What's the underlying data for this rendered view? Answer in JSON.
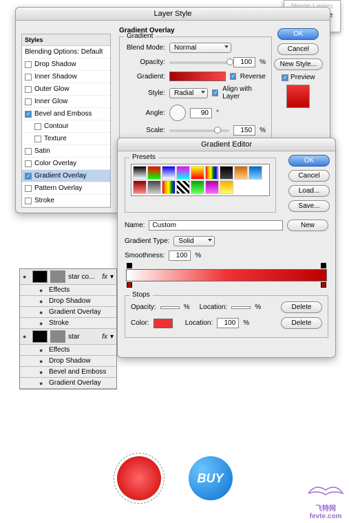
{
  "menu": {
    "merge_layers": "Merge Layers",
    "merge_visible": "Merge Visible"
  },
  "layer_style": {
    "title": "Layer Style",
    "styles_header": "Styles",
    "blending_default": "Blending Options: Default",
    "items": {
      "drop_shadow": "Drop Shadow",
      "inner_shadow": "Inner Shadow",
      "outer_glow": "Outer Glow",
      "inner_glow": "Inner Glow",
      "bevel_emboss": "Bevel and Emboss",
      "contour": "Contour",
      "texture": "Texture",
      "satin": "Satin",
      "color_overlay": "Color Overlay",
      "gradient_overlay": "Gradient Overlay",
      "pattern_overlay": "Pattern Overlay",
      "stroke": "Stroke"
    },
    "panel_title": "Gradient Overlay",
    "group_title": "Gradient",
    "blend_mode_label": "Blend Mode:",
    "blend_mode_value": "Normal",
    "opacity_label": "Opacity:",
    "opacity_value": "100",
    "gradient_label": "Gradient:",
    "reverse_label": "Reverse",
    "style_label": "Style:",
    "style_value": "Radial",
    "align_label": "Align with Layer",
    "angle_label": "Angle:",
    "angle_value": "90",
    "scale_label": "Scale:",
    "scale_value": "150",
    "percent": "%",
    "degree": "°",
    "buttons": {
      "ok": "OK",
      "cancel": "Cancel",
      "new_style": "New Style...",
      "preview": "Preview"
    }
  },
  "gradient_editor": {
    "title": "Gradient Editor",
    "presets_label": "Presets",
    "name_label": "Name:",
    "name_value": "Custom",
    "type_label": "Gradient Type:",
    "type_value": "Solid",
    "smoothness_label": "Smoothness:",
    "smoothness_value": "100",
    "percent": "%",
    "stops_label": "Stops",
    "opacity_label": "Opacity:",
    "location_label": "Location:",
    "location_value": "100",
    "color_label": "Color:",
    "buttons": {
      "ok": "OK",
      "cancel": "Cancel",
      "load": "Load...",
      "save": "Save...",
      "new": "New",
      "delete": "Delete"
    }
  },
  "layers_panel": {
    "star_co": "star co...",
    "star": "star",
    "effects": "Effects",
    "drop_shadow": "Drop Shadow",
    "gradient_overlay": "Gradient Overlay",
    "stroke": "Stroke",
    "bevel_emboss": "Bevel and Emboss",
    "fx": "fx"
  },
  "art": {
    "buy": "BUY"
  },
  "watermark": {
    "line1": "飞特网",
    "line2": "fevte.com"
  }
}
